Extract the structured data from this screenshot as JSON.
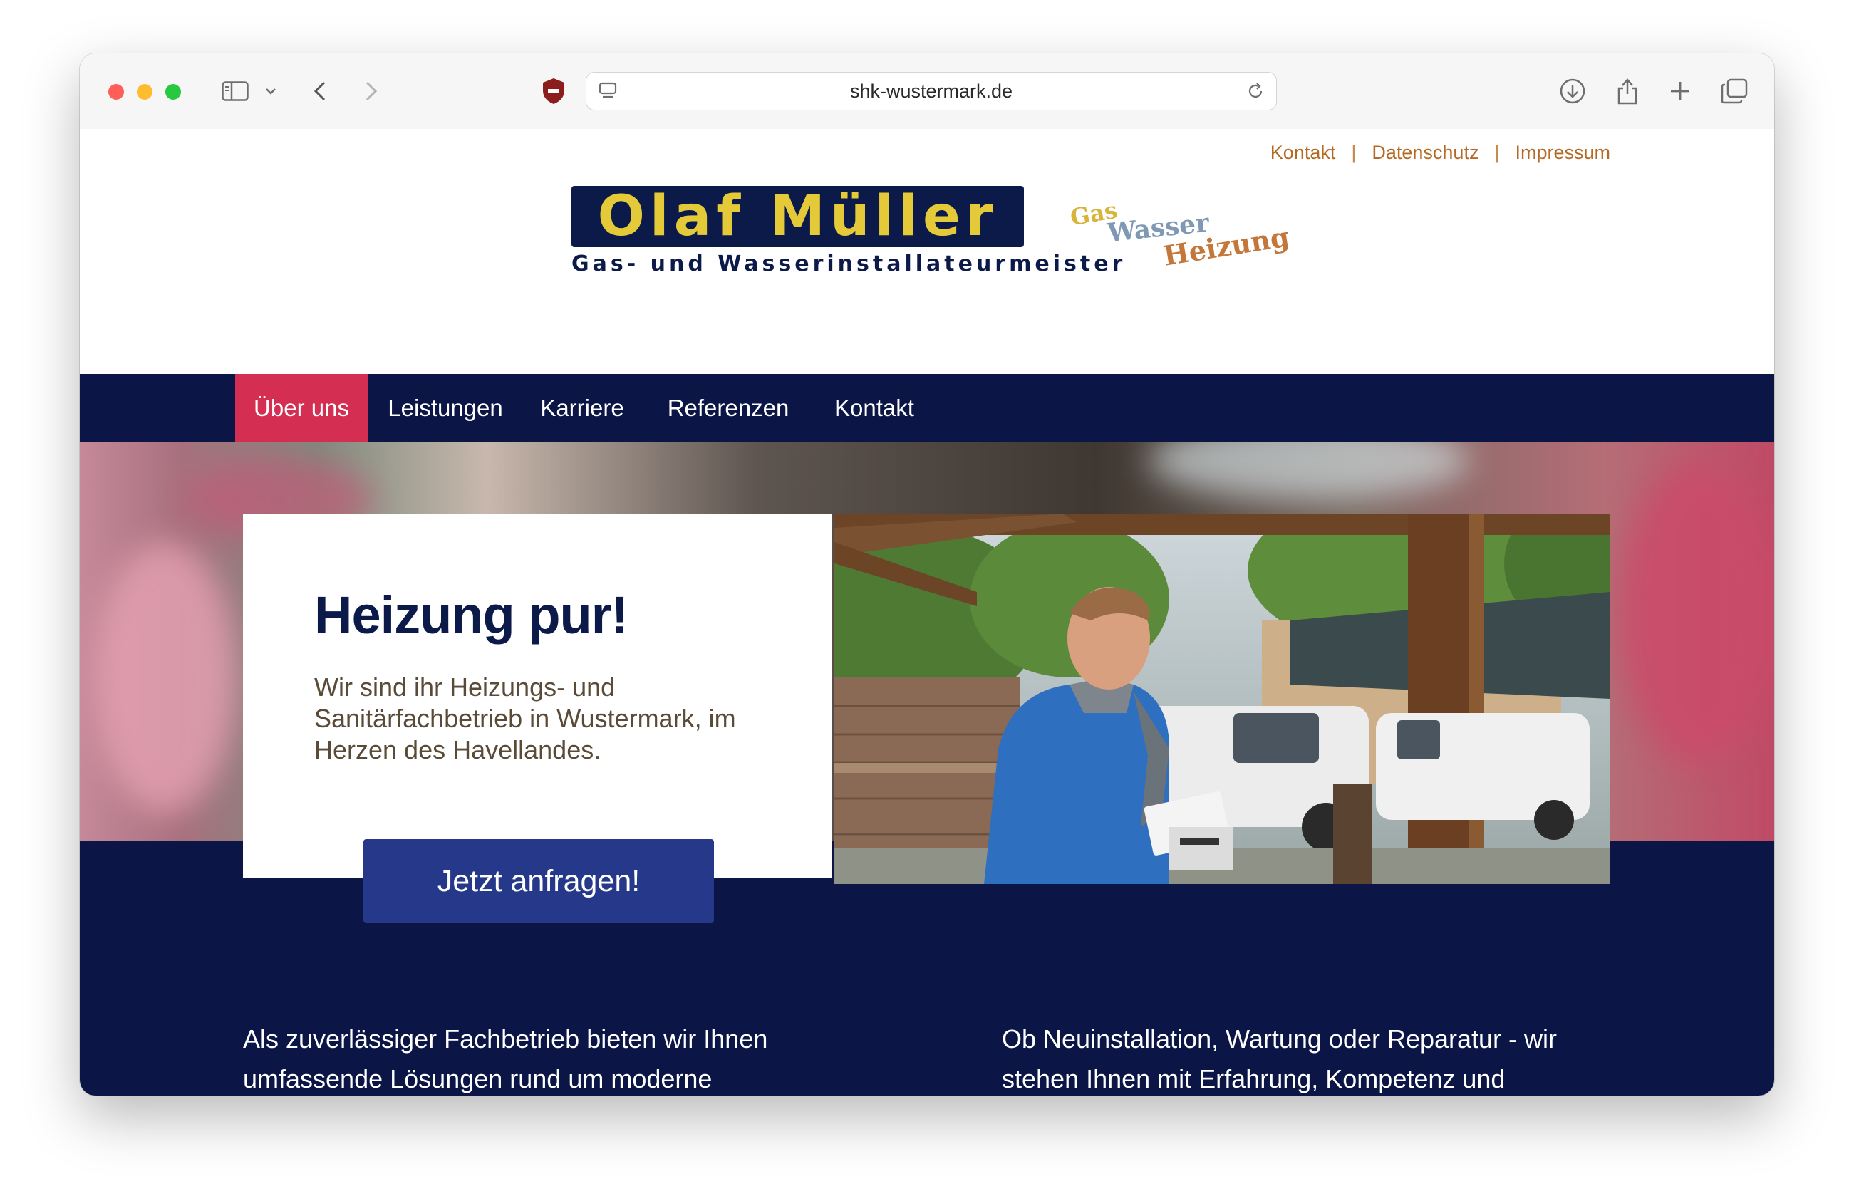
{
  "browser": {
    "url": "shk-wustermark.de"
  },
  "top_links": [
    "Kontakt",
    "Datenschutz",
    "Impressum"
  ],
  "top_links_separator": "|",
  "logo": {
    "name": "Olaf Müller",
    "subtitle": "Gas- und Wasserinstallateurmeister",
    "tagline": [
      "Gas",
      "Wasser",
      "Heizung"
    ]
  },
  "nav": {
    "items": [
      {
        "label": "Über uns",
        "active": true
      },
      {
        "label": "Leistungen",
        "active": false
      },
      {
        "label": "Karriere",
        "active": false
      },
      {
        "label": "Referenzen",
        "active": false
      },
      {
        "label": "Kontakt",
        "active": false
      }
    ]
  },
  "hero": {
    "title": "Heizung pur!",
    "text": "Wir sind ihr Heizungs- und Sanitärfachbetrieb in Wustermark, im Herzen des Havellandes.",
    "cta": "Jetzt anfragen!"
  },
  "intro": {
    "left": "Als zuverlässiger Fachbetrieb bieten wir Ihnen umfassende Lösungen rund um moderne Heizungsanlagen, effiziente Sanitärtechnik und",
    "right": "Ob Neuinstallation, Wartung oder Reparatur - wir stehen Ihnen mit Erfahrung, Kompetenz und persönlichem Service zur Seite. Vertrauen Sie auf"
  },
  "colors": {
    "navy": "#0b1646",
    "accent_red": "#d42f52",
    "cta_blue": "#26388a",
    "logo_yellow": "#e4c938",
    "link_brown": "#b46a24"
  },
  "icons": [
    "sidebar-icon",
    "chevron-down-icon",
    "back-icon",
    "forward-icon",
    "shield-icon",
    "reader-icon",
    "reload-icon",
    "download-icon",
    "share-icon",
    "new-tab-icon",
    "tab-overview-icon"
  ]
}
